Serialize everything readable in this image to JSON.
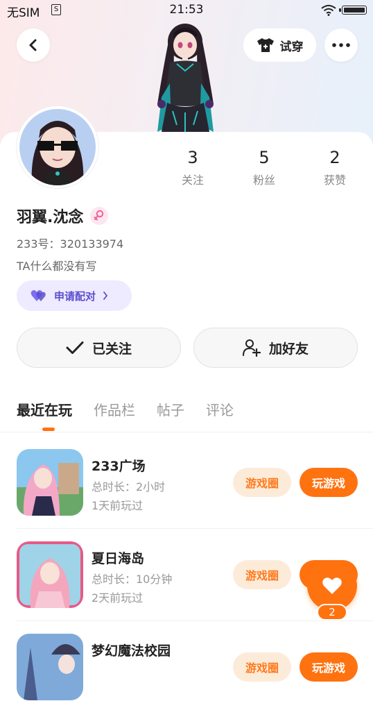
{
  "status_bar": {
    "carrier": "无SIM",
    "sim_glyph": "S",
    "time": "21:53"
  },
  "header": {
    "try_on_label": "试穿"
  },
  "profile": {
    "name": "羽翼.沈念",
    "uid": "233号：320133974",
    "bio": "TA什么都没有写",
    "match_label": "申请配对",
    "stats": [
      {
        "value": "3",
        "label": "关注"
      },
      {
        "value": "5",
        "label": "粉丝"
      },
      {
        "value": "2",
        "label": "获赞"
      }
    ],
    "follow_label": "已关注",
    "add_friend_label": "加好友"
  },
  "tabs": [
    {
      "label": "最近在玩",
      "active": true
    },
    {
      "label": "作品栏",
      "active": false
    },
    {
      "label": "帖子",
      "active": false
    },
    {
      "label": "评论",
      "active": false
    }
  ],
  "games": [
    {
      "title": "233广场",
      "duration": "总时长：2小时",
      "last_played": "1天前玩过",
      "circle_label": "游戏圈",
      "play_label": "玩游戏"
    },
    {
      "title": "夏日海岛",
      "duration": "总时长：10分钟",
      "last_played": "2天前玩过",
      "circle_label": "游戏圈",
      "play_label": "玩游戏"
    },
    {
      "title": "梦幻魔法校园",
      "duration": "",
      "last_played": "",
      "circle_label": "游戏圈",
      "play_label": "玩游戏"
    }
  ],
  "like_fab": {
    "count": "2"
  },
  "colors": {
    "accent": "#ff7210",
    "match_purple": "#5b4fcf"
  }
}
